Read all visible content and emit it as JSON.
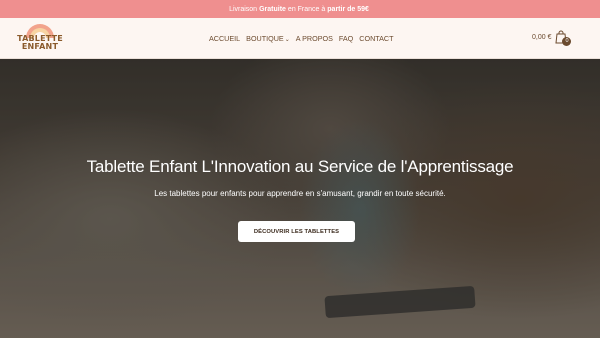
{
  "announcement": {
    "prefix": "Livraison",
    "bold": "Gratuite",
    "middle": "en France à",
    "suffix": "partir de 59€"
  },
  "logo": {
    "line1": "TABLETTE",
    "line2": "ENFANT"
  },
  "nav": {
    "items": [
      "ACCUEIL",
      "BOUTIQUE",
      "A PROPOS",
      "FAQ",
      "CONTACT"
    ]
  },
  "cart": {
    "price": "0,00 €",
    "count": "0"
  },
  "hero": {
    "title": "Tablette Enfant L'Innovation au Service de l'Apprentissage",
    "subtitle": "Les tablettes pour enfants pour apprendre en s'amusant, grandir en toute sécurité.",
    "cta": "DÉCOUVRIR LES TABLETTES"
  },
  "colors": {
    "announce_bg": "#ef8f8f",
    "brand_brown": "#6b4a2e",
    "page_bg": "#fdf6f2"
  }
}
